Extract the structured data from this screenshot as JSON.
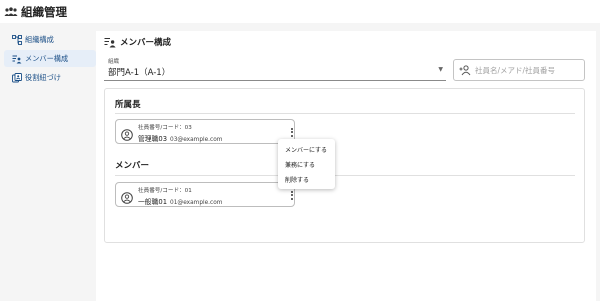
{
  "app": {
    "title": "組織管理",
    "icon": "organization-icon"
  },
  "sidebar": {
    "items": [
      {
        "label": "組織構成",
        "icon": "org-tree-icon",
        "active": false
      },
      {
        "label": "メンバー構成",
        "icon": "member-list-icon",
        "active": true
      },
      {
        "label": "役割紐づけ",
        "icon": "role-link-icon",
        "active": false
      }
    ]
  },
  "main": {
    "section_title": "メンバー構成",
    "section_icon": "member-list-icon",
    "org_select": {
      "label": "組織",
      "value": "部門A-1（A-1）"
    },
    "search": {
      "placeholder": "社員名/メアド/社員番号",
      "value": ""
    },
    "groups": {
      "head": {
        "title": "所属長",
        "members": [
          {
            "meta": "社員番号/コード：03",
            "name": "管理職03",
            "email": "03@example.com"
          }
        ]
      },
      "member": {
        "title": "メンバー",
        "members": [
          {
            "meta": "社員番号/コード：01",
            "name": "一般職01",
            "email": "01@example.com"
          }
        ]
      }
    },
    "context_menu": {
      "items": [
        {
          "label": "メンバーにする"
        },
        {
          "label": "兼務にする"
        },
        {
          "label": "削除する"
        }
      ]
    }
  },
  "colors": {
    "accent": "#1b4f87",
    "active_bg": "#e6eef8",
    "page_bg": "#f5f5f5"
  }
}
